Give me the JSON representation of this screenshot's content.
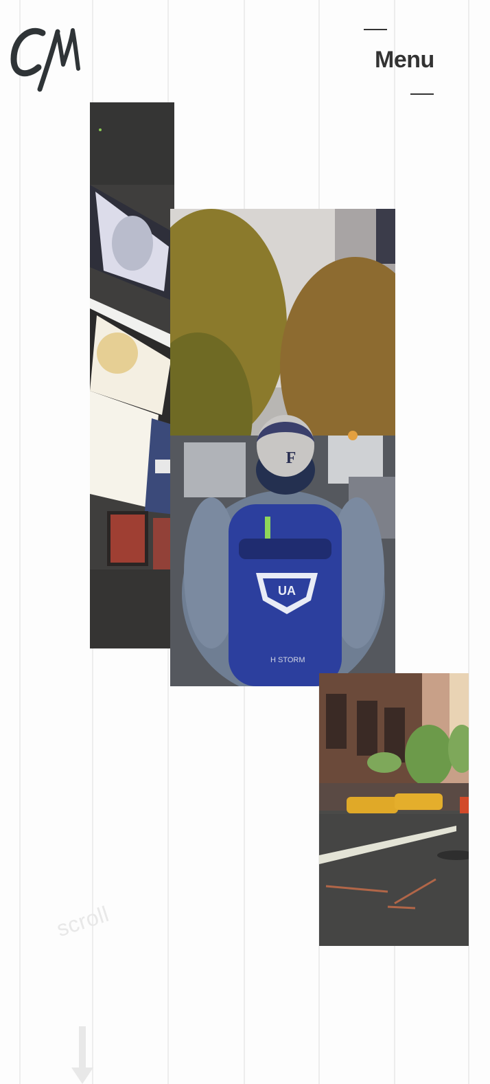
{
  "header": {
    "logo_text": "CM",
    "menu_label": "Menu"
  },
  "gallery": {
    "items": [
      {
        "name": "times-square-billboards-photo",
        "colors": {
          "dark": "#3f3e3d",
          "light": "#f2efe6"
        }
      },
      {
        "name": "backpack-street-photo",
        "colors": {
          "sky": "#d6d3d0",
          "trees": "#8a7a2a",
          "backpack": "#2c3f9e",
          "cap": "#c8c6c4"
        }
      },
      {
        "name": "taxi-street-photo",
        "colors": {
          "asphalt": "#4a4a48",
          "taxi": "#e0a928",
          "building": "#6b4a3a"
        }
      }
    ]
  },
  "scroll_hint": {
    "label": "scroll",
    "icon": "arrow-down-icon"
  },
  "colors": {
    "background": "#fdfdfd",
    "gridline": "#ededed",
    "text": "#333333",
    "hint": "#e8e8e8"
  }
}
